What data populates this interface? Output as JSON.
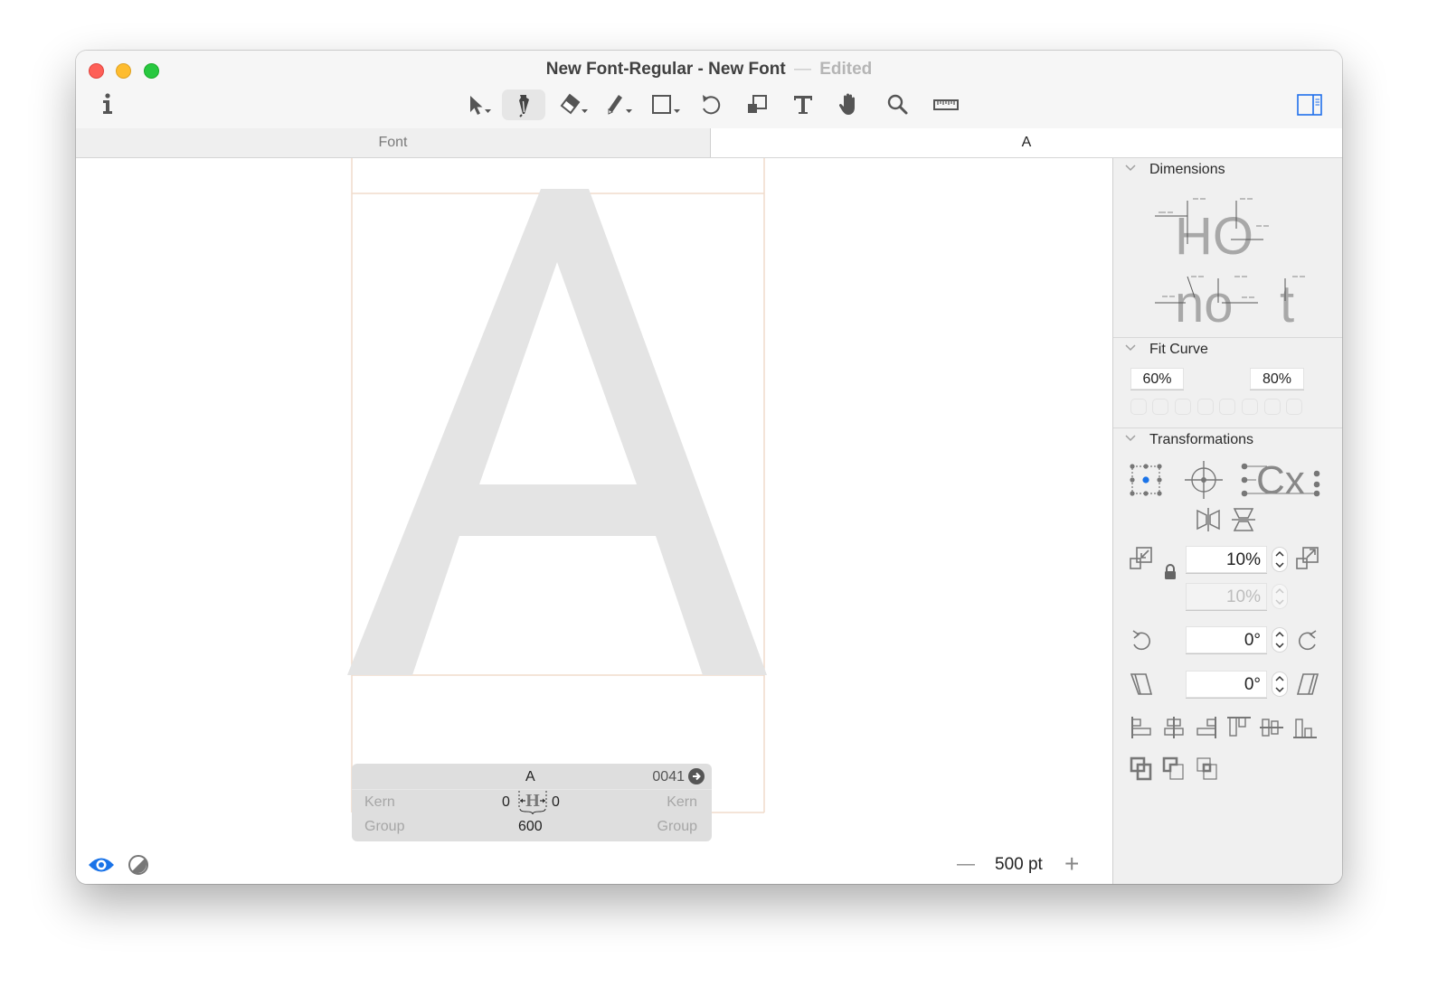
{
  "window": {
    "title": "New Font-Regular - New Font",
    "title_separator": "—",
    "edited_label": "Edited"
  },
  "toolbar": {
    "tools": [
      {
        "name": "select-tool",
        "icon": "arrow-pointer-icon",
        "has_menu": true,
        "active": false
      },
      {
        "name": "pen-tool",
        "icon": "pen-nib-icon",
        "has_menu": false,
        "active": true
      },
      {
        "name": "eraser-tool",
        "icon": "eraser-icon",
        "has_menu": true,
        "active": false
      },
      {
        "name": "pencil-tool",
        "icon": "pencil-icon",
        "has_menu": true,
        "active": false
      },
      {
        "name": "rectangle-tool",
        "icon": "rectangle-icon",
        "has_menu": true,
        "active": false
      },
      {
        "name": "rotate-tool",
        "icon": "rotate-icon",
        "has_menu": false,
        "active": false
      },
      {
        "name": "scale-tool",
        "icon": "scale-icon",
        "has_menu": false,
        "active": false
      },
      {
        "name": "text-tool",
        "icon": "text-icon",
        "has_menu": false,
        "active": false
      },
      {
        "name": "hand-tool",
        "icon": "hand-icon",
        "has_menu": false,
        "active": false
      },
      {
        "name": "zoom-tool",
        "icon": "magnifier-icon",
        "has_menu": false,
        "active": false
      },
      {
        "name": "measure-tool",
        "icon": "ruler-icon",
        "has_menu": false,
        "active": false
      }
    ],
    "accent_color": "#1f6feb"
  },
  "tabs": [
    {
      "label": "Font",
      "active": false
    },
    {
      "label": "A",
      "active": true
    }
  ],
  "canvas": {
    "glyph_char": "A",
    "glyph_color": "#e4e4e4",
    "metric_line_color": "#f0dccb"
  },
  "info_bar": {
    "glyph_name": "A",
    "unicode": "0041",
    "left_kern_label": "Kern",
    "right_kern_label": "Kern",
    "left_kern_value": "0",
    "right_kern_value": "0",
    "left_group_label": "Group",
    "right_group_label": "Group",
    "width_value": "600"
  },
  "bottom_bar": {
    "zoom_value": "500 pt",
    "zoom_out_symbol": "—",
    "zoom_in_symbol": "+"
  },
  "panel": {
    "dimensions": {
      "title": "Dimensions",
      "preview_line1": "HO",
      "preview_line2": "no",
      "preview_line3": "t"
    },
    "fit_curve": {
      "title": "Fit Curve",
      "min_value": "60%",
      "max_value": "80%",
      "preset_count": 8
    },
    "transformations": {
      "title": "Transformations",
      "cx_label": "Cx",
      "scale_x": "10%",
      "scale_y": "10%",
      "rotate": "0°",
      "slant": "0°"
    }
  }
}
